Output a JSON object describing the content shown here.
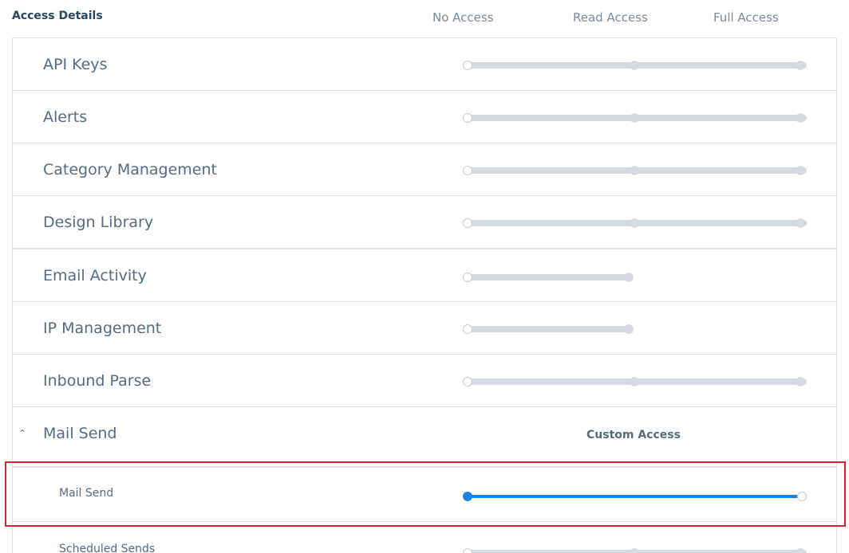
{
  "header": {
    "title": "Access Details",
    "col_no": "No Access",
    "col_read": "Read Access",
    "col_full": "Full Access"
  },
  "rows": [
    {
      "label": "API Keys",
      "access_level": "no_access"
    },
    {
      "label": "Alerts",
      "access_level": "no_access"
    },
    {
      "label": "Category Management",
      "access_level": "no_access"
    },
    {
      "label": "Design Library",
      "access_level": "no_access"
    },
    {
      "label": "Email Activity",
      "access_level": "no_access"
    },
    {
      "label": "IP Management",
      "access_level": "no_access"
    },
    {
      "label": "Inbound Parse",
      "access_level": "no_access"
    }
  ],
  "mail_send_group": {
    "label": "Mail Send",
    "custom_label": "Custom Access",
    "expanded": true,
    "sub_items": [
      {
        "label": "Mail Send",
        "access_level": "no_access",
        "selected": true
      },
      {
        "label": "Scheduled Sends",
        "access_level": "no_access"
      }
    ]
  },
  "colors": {
    "accent": "#1a82e2",
    "highlight_border": "#d9232c"
  }
}
